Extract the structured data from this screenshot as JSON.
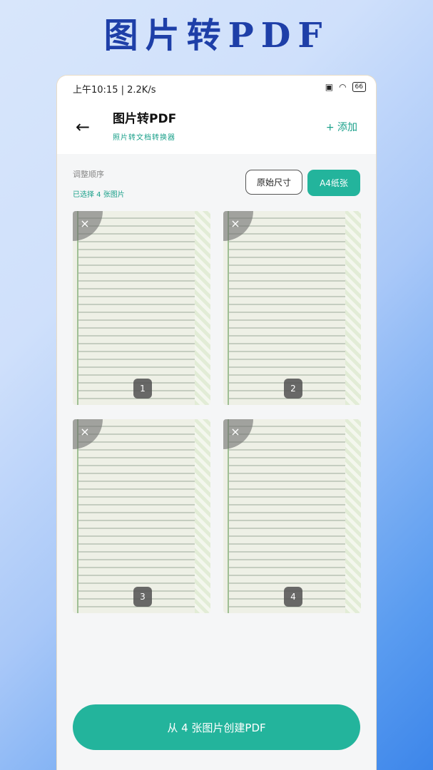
{
  "banner": "图片转PDF",
  "status": {
    "time": "上午10:15",
    "speed": "2.2K/s",
    "battery": "66"
  },
  "appbar": {
    "title": "图片转PDF",
    "subtitle": "照片转文档转换器",
    "add_label": "+ 添加"
  },
  "order": {
    "label": "调整顺序",
    "selected": "已选择 4 张图片",
    "original_size": "原始尺寸",
    "a4": "A4纸张"
  },
  "thumbnails": [
    {
      "index": "1"
    },
    {
      "index": "2"
    },
    {
      "index": "3"
    },
    {
      "index": "4"
    }
  ],
  "remove_symbol": "×",
  "cta": "从 4 张图片创建PDF",
  "colors": {
    "accent": "#23b49c",
    "banner": "#1e3fa8"
  }
}
